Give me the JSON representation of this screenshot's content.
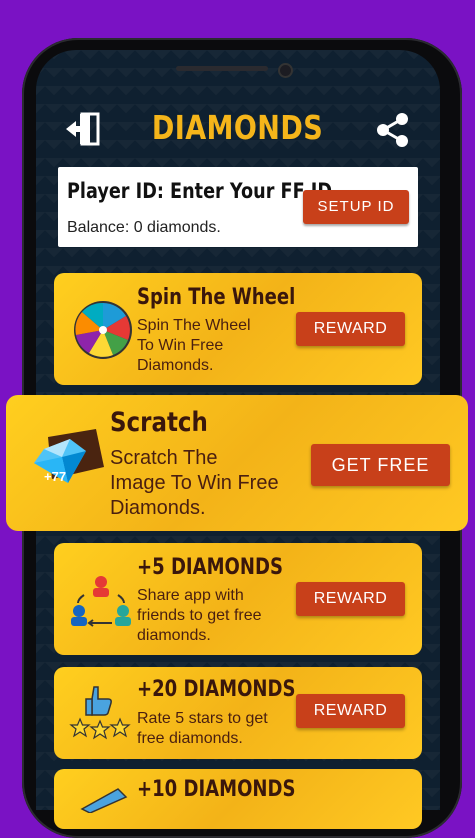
{
  "header": {
    "title": "DIAMONDS"
  },
  "player": {
    "title": "Player ID: Enter Your FF ID",
    "balance": "Balance: 0 diamonds.",
    "setup_label": "SETUP ID"
  },
  "cards": [
    {
      "title": "Spin The Wheel",
      "desc": [
        "Spin The Wheel",
        "To Win Free",
        "Diamonds."
      ],
      "button": "REWARD",
      "icon": "spin-wheel-icon"
    },
    {
      "title": "Scratch",
      "desc": [
        "Scratch The",
        "Image To Win Free",
        "Diamonds."
      ],
      "button": "GET FREE",
      "icon": "scratch-diamond-icon",
      "badge": "+77"
    },
    {
      "title": "+5 DIAMONDS",
      "desc": [
        "Share app with",
        "friends to get free",
        "diamonds."
      ],
      "button": "REWARD",
      "icon": "share-friends-icon"
    },
    {
      "title": "+20 DIAMONDS",
      "desc": [
        "Rate 5 stars to get",
        "free diamonds."
      ],
      "button": "REWARD",
      "icon": "thumbs-up-stars-icon"
    },
    {
      "title": "+10 DIAMONDS",
      "icon": "diamond-icon"
    }
  ],
  "colors": {
    "accent": "#f5b51a",
    "button": "#c8401a",
    "card": "#ffc61f",
    "background": "#7a12c4"
  }
}
